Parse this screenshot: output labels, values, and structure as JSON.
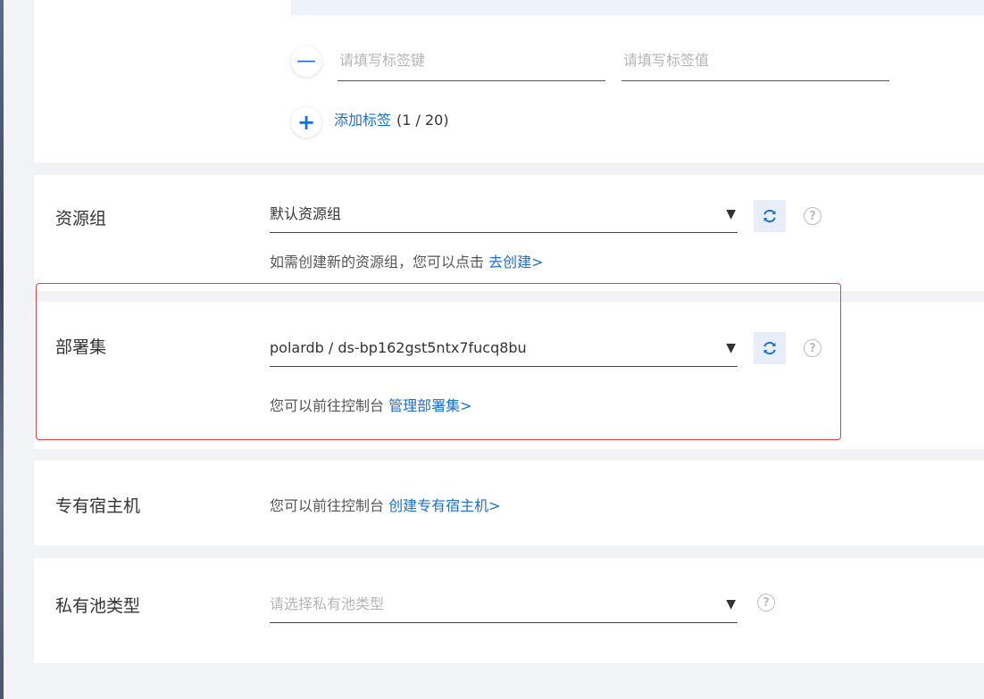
{
  "tags": {
    "key_placeholder": "请填写标签键",
    "value_placeholder": "请填写标签值",
    "add_label": "添加标签",
    "count_label": "(1 / 20)"
  },
  "resource_group": {
    "label": "资源组",
    "selected": "默认资源组",
    "hint_text": "如需创建新的资源组，您可以点击",
    "hint_link": "去创建>"
  },
  "deployment_set": {
    "label": "部署集",
    "selected": "polardb / ds-bp162gst5ntx7fucq8bu",
    "hint_text": "您可以前往控制台",
    "hint_link": "管理部署集>"
  },
  "dedicated_host": {
    "label": "专有宿主机",
    "hint_text": "您可以前往控制台",
    "hint_link": "创建专有宿主机>"
  },
  "private_pool": {
    "label": "私有池类型",
    "placeholder": "请选择私有池类型"
  },
  "icons": {
    "minus": "minus-icon",
    "plus": "plus-icon",
    "caret": "caret-down-icon",
    "refresh": "refresh-icon",
    "help": "question-circle-icon"
  },
  "colors": {
    "link": "#1a6fd1",
    "highlight": "#e84040",
    "refresh_bg": "#e7eef9"
  }
}
